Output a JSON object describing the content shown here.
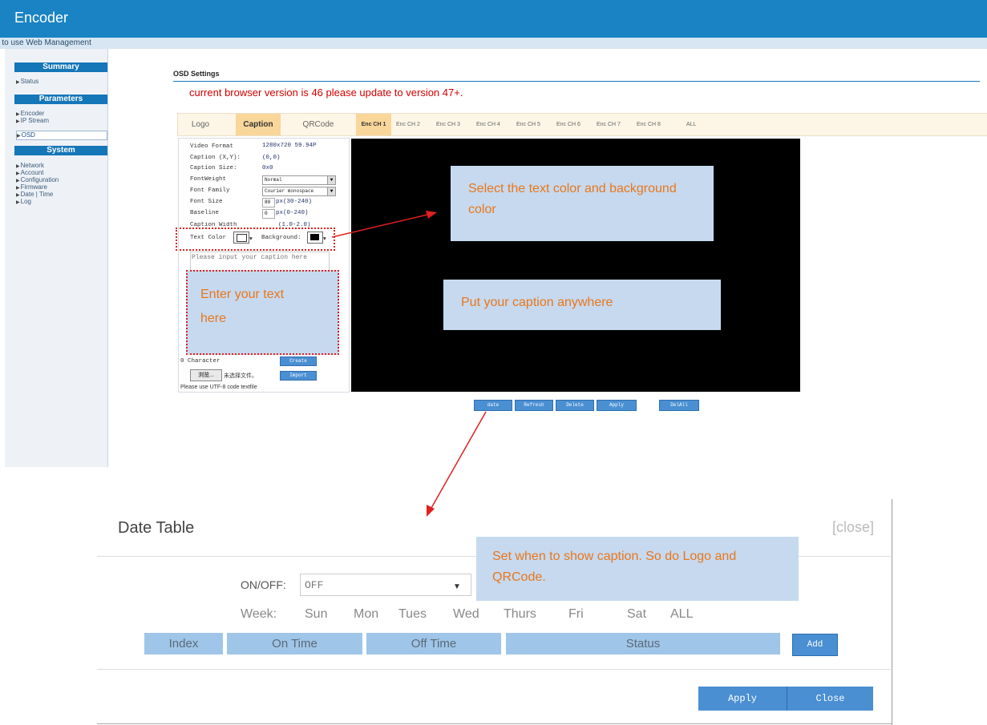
{
  "header": {
    "title": "Encoder",
    "subtitle": "e to use Web Management"
  },
  "sidebar": {
    "sections": [
      {
        "label": "Summary",
        "items": [
          "Status"
        ]
      },
      {
        "label": "Parameters",
        "items": [
          "Encoder",
          "IP Stream",
          "OSD"
        ]
      },
      {
        "label": "System",
        "items": [
          "Network",
          "Account",
          "Configuration",
          "Firmware",
          "Date | Time",
          "Log"
        ]
      }
    ],
    "selected": "OSD"
  },
  "page": {
    "title": "OSD Settings",
    "warning": "current browser version is 46 please update to version 47+."
  },
  "tabs": {
    "items": [
      "Logo",
      "Caption",
      "QRCode"
    ],
    "active": "Caption"
  },
  "channels": {
    "items": [
      "Enc CH 1",
      "Enc CH 2",
      "Enc CH 3",
      "Enc CH 4",
      "Enc CH 5",
      "Enc CH 6",
      "Enc CH 7",
      "Enc CH 8",
      "ALL"
    ],
    "active": "Enc CH 1"
  },
  "caption_form": {
    "video_format_label": "Video Format",
    "video_format_value": "1280x720 59.94P",
    "caption_xy_label": "Caption (X,Y):",
    "caption_xy_value": "(0,0)",
    "caption_size_label": "Caption Size:",
    "caption_size_value": "0x0",
    "font_weight_label": "FontWeight",
    "font_weight_value": "Normal",
    "font_family_label": "Font Family",
    "font_family_value": "Courier monospace",
    "font_size_label": "Font Size",
    "font_size_value": "80",
    "font_size_unit": "px(30-240)",
    "baseline_label": "Baseline",
    "baseline_value": "0",
    "baseline_unit": "px(0-240)",
    "caption_width_label": "Caption Width",
    "caption_width_unit": "(1.0-2.0)",
    "text_color_label": "Text Color",
    "text_color_value": "#ffffff",
    "background_label": "Background:",
    "background_value": "#000000",
    "caption_placeholder": "Please input your caption here",
    "char_count": "0 Character",
    "create_button": "Create",
    "browse_button": "浏览...",
    "no_file": "未选择文件。",
    "import_button": "Import",
    "utf8_note": "Please use UTF-8 code textfile"
  },
  "callouts": {
    "colors": "Select the text color and background color",
    "enter_text": "Enter your text here",
    "anywhere": "Put your caption anywhere",
    "schedule": "Set when to show caption. So do Logo and QRCode."
  },
  "bottom_buttons": [
    "date",
    "Refresh",
    "Delete",
    "Apply",
    "DelAll"
  ],
  "date_table": {
    "title": "Date Table",
    "close": "[close]",
    "onoff_label": "ON/OFF:",
    "onoff_value": "OFF",
    "week_label": "Week:",
    "days": [
      "Sun",
      "Mon",
      "Tues",
      "Wed",
      "Thurs",
      "Fri",
      "Sat",
      "ALL"
    ],
    "columns": [
      "Index",
      "On Time",
      "Off Time",
      "Status"
    ],
    "add_button": "Add",
    "apply_button": "Apply",
    "close_button": "Close"
  },
  "colors": {
    "brand": "#1a83c4",
    "accent": "#4a8fd2",
    "warning": "#d10000",
    "callout_text": "#e8771a",
    "annotation": "#e02020"
  }
}
